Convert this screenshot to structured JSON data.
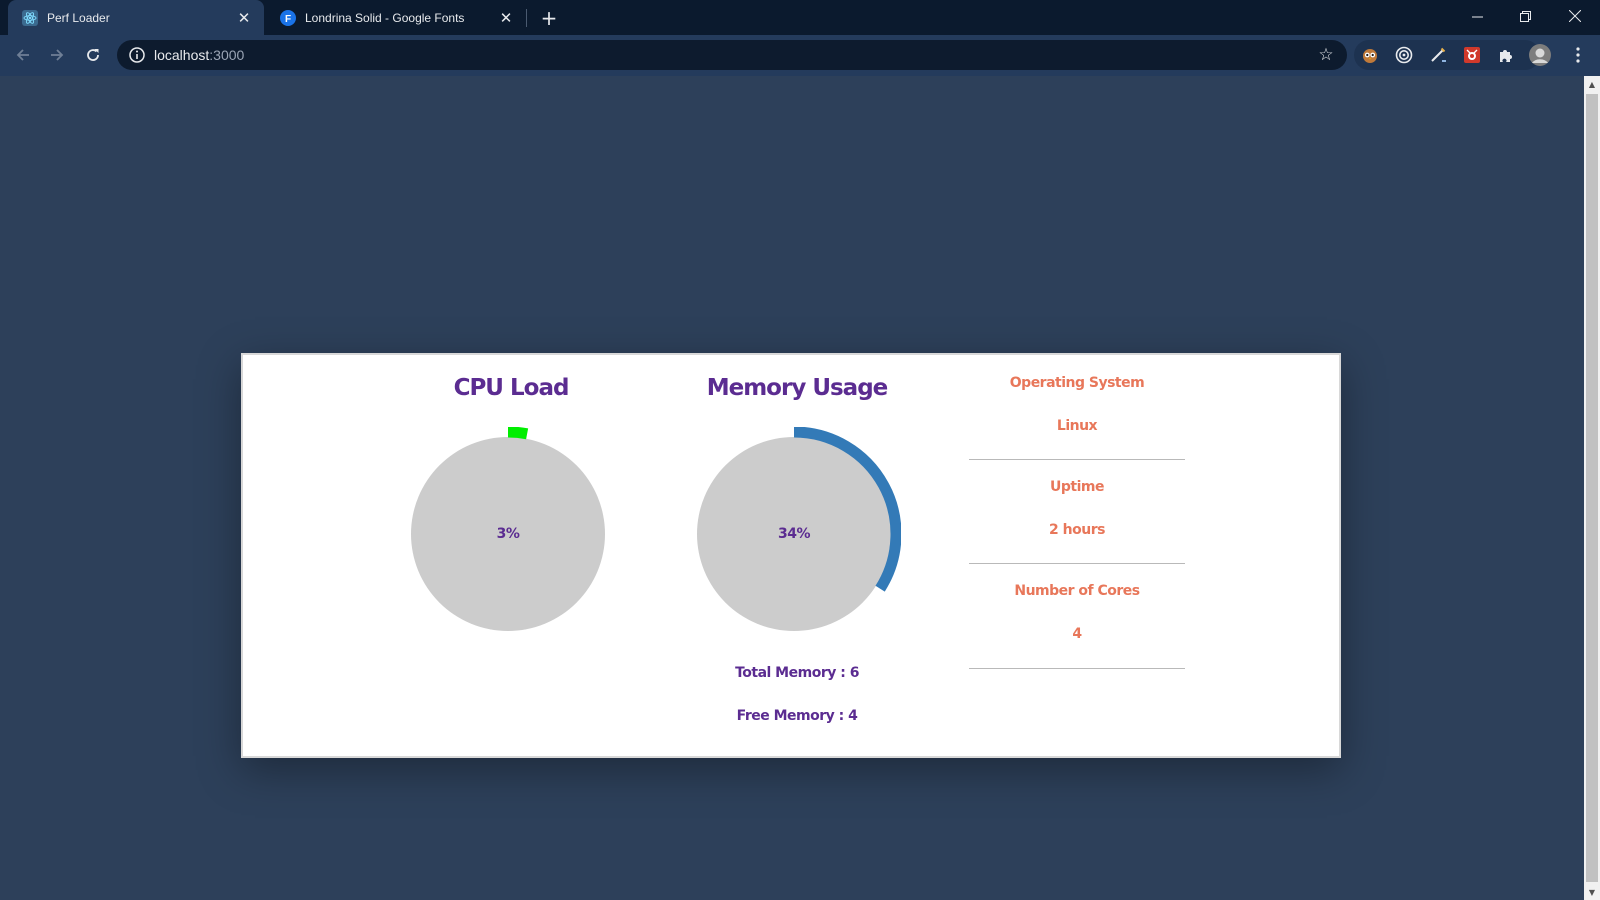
{
  "browser": {
    "tabs": [
      {
        "title": "Perf Loader",
        "icon": "react-icon",
        "active": true
      },
      {
        "title": "Londrina Solid - Google Fonts",
        "icon": "google-fonts-icon",
        "active": false
      }
    ],
    "url_host": "localhost",
    "url_port": ":3000",
    "extensions": [
      "owl-extension-icon",
      "target-extension-icon",
      "pen-extension-icon",
      "bug-extension-icon",
      "puzzle-extensions-icon",
      "profile-avatar-icon"
    ]
  },
  "dashboard": {
    "cpu": {
      "title": "CPU Load",
      "value_label": "3%",
      "percent": 3,
      "arc_color": "#00ee00"
    },
    "memory": {
      "title": "Memory Usage",
      "value_label": "34%",
      "percent": 34,
      "arc_color": "#337ab7",
      "total_label": "Total Memory : 6",
      "free_label": "Free Memory : 4"
    },
    "info": [
      {
        "label": "Operating System",
        "value": "Linux"
      },
      {
        "label": "Uptime",
        "value": "2 hours"
      },
      {
        "label": "Number of Cores",
        "value": "4"
      }
    ]
  },
  "colors": {
    "title_purple": "#5b2c91",
    "info_orange": "#e8775a",
    "gauge_fill": "#cccccc",
    "page_background": "#2d405a"
  }
}
